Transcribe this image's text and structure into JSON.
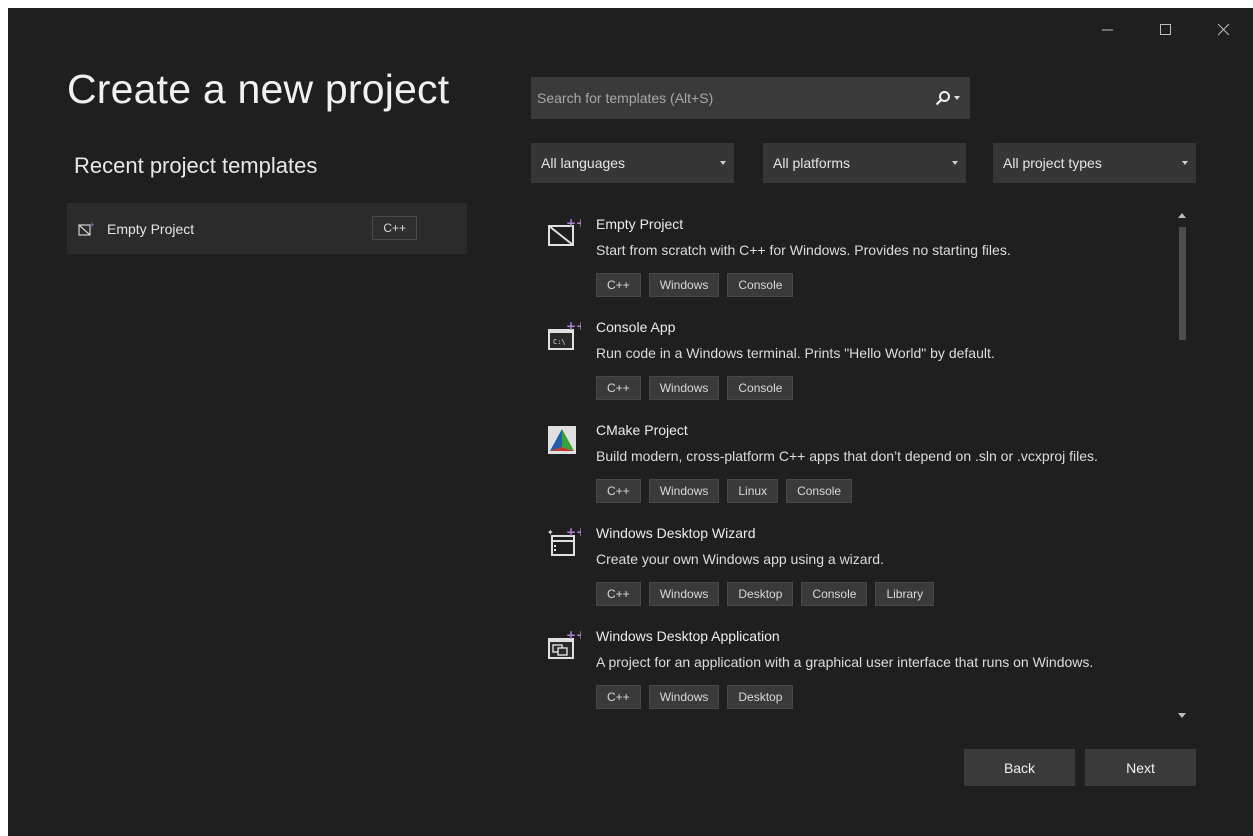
{
  "page_title": "Create a new project",
  "recent": {
    "title": "Recent project templates",
    "items": [
      {
        "label": "Empty Project",
        "tag": "C++",
        "icon": "empty-project-icon"
      }
    ]
  },
  "search": {
    "placeholder": "Search for templates (Alt+S)",
    "value": ""
  },
  "filters": {
    "language": "All languages",
    "platform": "All platforms",
    "project_type": "All project types"
  },
  "templates": [
    {
      "name": "Empty Project",
      "description": "Start from scratch with C++ for Windows. Provides no starting files.",
      "tags": [
        "C++",
        "Windows",
        "Console"
      ],
      "icon": "empty-project-icon"
    },
    {
      "name": "Console App",
      "description": "Run code in a Windows terminal. Prints \"Hello World\" by default.",
      "tags": [
        "C++",
        "Windows",
        "Console"
      ],
      "icon": "console-app-icon"
    },
    {
      "name": "CMake Project",
      "description": "Build modern, cross-platform C++ apps that don’t depend on .sln or .vcxproj files.",
      "tags": [
        "C++",
        "Windows",
        "Linux",
        "Console"
      ],
      "icon": "cmake-icon"
    },
    {
      "name": "Windows Desktop Wizard",
      "description": "Create your own Windows app using a wizard.",
      "tags": [
        "C++",
        "Windows",
        "Desktop",
        "Console",
        "Library"
      ],
      "icon": "wizard-icon"
    },
    {
      "name": "Windows Desktop Application",
      "description": "A project for an application with a graphical user interface that runs on Windows.",
      "tags": [
        "C++",
        "Windows",
        "Desktop"
      ],
      "icon": "desktop-app-icon"
    }
  ],
  "buttons": {
    "back": "Back",
    "next": "Next"
  },
  "colors": {
    "background": "#1f1f1f",
    "panel": "#2b2b2b",
    "accent": "#b180d7",
    "text": "#e6e6e6"
  }
}
